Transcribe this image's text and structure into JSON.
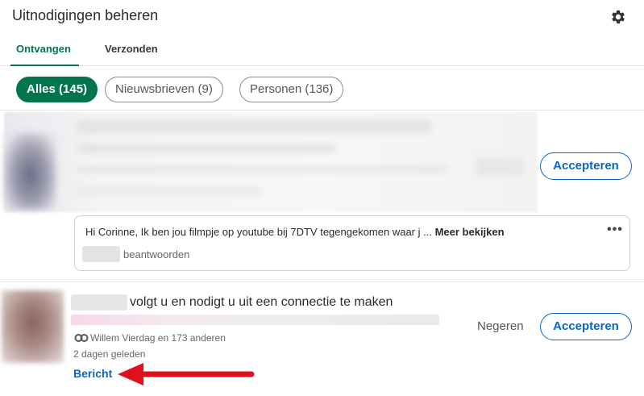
{
  "header": {
    "title": "Uitnodigingen beheren",
    "settings_icon": "gear-icon"
  },
  "tabs": [
    {
      "label": "Ontvangen",
      "active": true
    },
    {
      "label": "Verzonden",
      "active": false
    }
  ],
  "filters": [
    {
      "label": "Alles (145)",
      "active": true
    },
    {
      "label": "Nieuwsbrieven (9)",
      "active": false
    },
    {
      "label": "Personen (136)",
      "active": false
    }
  ],
  "invitations": [
    {
      "accept_label": "Accepteren",
      "message": {
        "text": "Hi Corinne, Ik ben jou filmpje op youtube bij 7DTV tegengekomen waar j ...",
        "more_label": "Meer bekijken",
        "more_icon": "more-options-icon",
        "reply_label": "beantwoorden"
      }
    },
    {
      "invite_text": "volgt u en nodigt u uit een connectie te maken",
      "mutual_text": "Willem Vierdag en 173 anderen",
      "time_text": "2 dagen geleden",
      "message_label": "Bericht",
      "ignore_label": "Negeren",
      "accept_label": "Accepteren"
    }
  ],
  "colors": {
    "accent_green": "#01754f",
    "link_blue": "#0a66c2",
    "annotation_red": "#e0101f"
  }
}
